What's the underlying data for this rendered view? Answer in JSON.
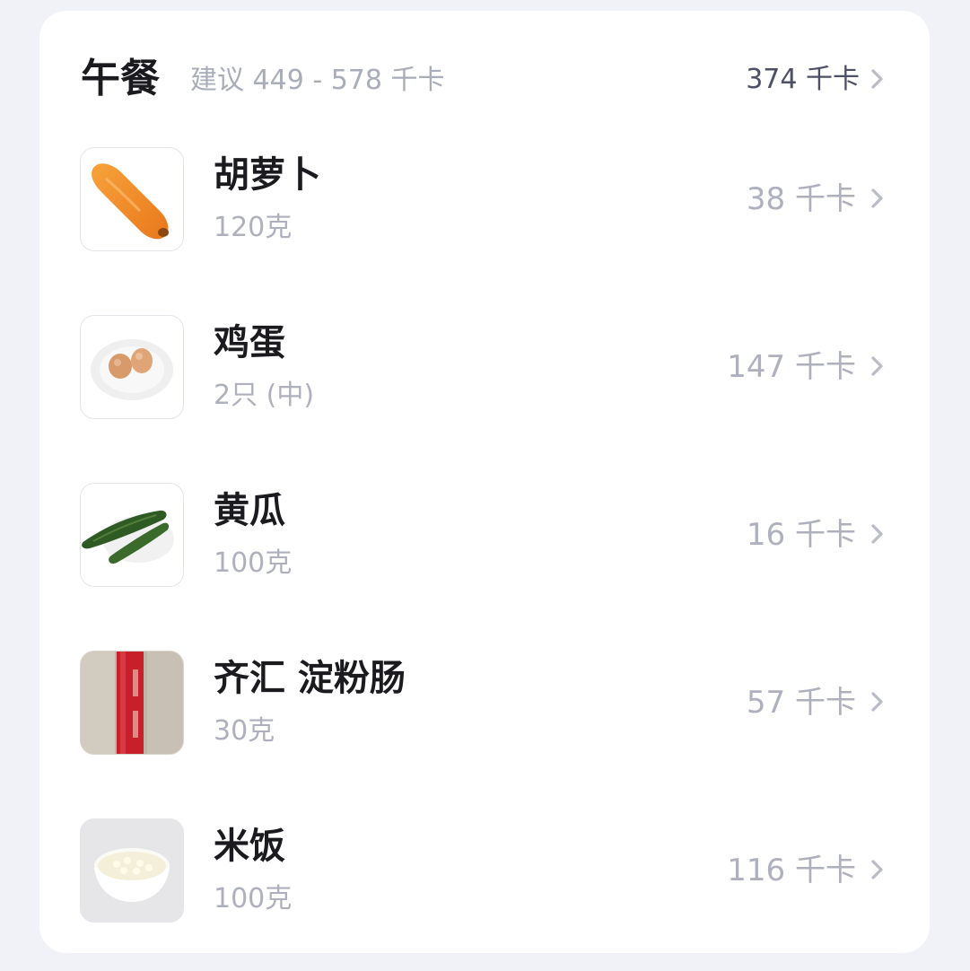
{
  "meal": {
    "title": "午餐",
    "suggestion": "建议 449 - 578 千卡",
    "total": "374 千卡"
  },
  "items": [
    {
      "name": "胡萝卜",
      "quantity": "120克",
      "kcal": "38 千卡",
      "icon": "carrot-image"
    },
    {
      "name": "鸡蛋",
      "quantity": "2只 (中)",
      "kcal": "147 千卡",
      "icon": "eggs-on-plate-image"
    },
    {
      "name": "黄瓜",
      "quantity": "100克",
      "kcal": "16 千卡",
      "icon": "cucumber-image"
    },
    {
      "name": "齐汇 淀粉肠",
      "quantity": "30克",
      "kcal": "57 千卡",
      "icon": "starch-sausage-image"
    },
    {
      "name": "米饭",
      "quantity": "100克",
      "kcal": "116 千卡",
      "icon": "rice-bowl-image"
    }
  ],
  "colors": {
    "background": "#f1f2f7",
    "card": "#ffffff",
    "title_text": "#1b1b1f",
    "muted_text": "#aeb0bd",
    "chevron": "#b9bbc6"
  }
}
